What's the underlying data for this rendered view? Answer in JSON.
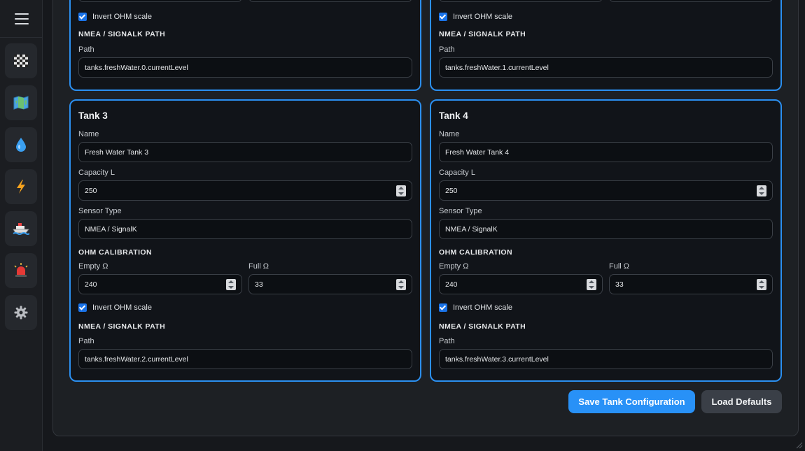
{
  "sidebar": {
    "menu_icon": "hamburger-menu-icon",
    "items": [
      {
        "icon": "checkered-flag-icon",
        "glyph": "🏁"
      },
      {
        "icon": "map-icon",
        "glyph": "🗺️"
      },
      {
        "icon": "water-drop-icon",
        "glyph": "💧"
      },
      {
        "icon": "lightning-icon",
        "glyph": "⚡"
      },
      {
        "icon": "boat-icon",
        "glyph": "🚢"
      },
      {
        "icon": "alarm-light-icon",
        "glyph": "🚨"
      },
      {
        "icon": "gear-icon",
        "glyph": "⚙️"
      }
    ]
  },
  "tanks_top": [
    {
      "invert_label": "Invert OHM scale",
      "path_section": "NMEA / SIGNALK PATH",
      "path_label": "Path",
      "path_value": "tanks.freshWater.0.currentLevel"
    },
    {
      "invert_label": "Invert OHM scale",
      "path_section": "NMEA / SIGNALK PATH",
      "path_label": "Path",
      "path_value": "tanks.freshWater.1.currentLevel"
    }
  ],
  "tanks": [
    {
      "title": "Tank 3",
      "name_label": "Name",
      "name_value": "Fresh Water Tank 3",
      "capacity_label": "Capacity L",
      "capacity_value": "250",
      "sensor_label": "Sensor Type",
      "sensor_value": "NMEA / SignalK",
      "ohm_section": "OHM CALIBRATION",
      "empty_label": "Empty Ω",
      "empty_value": "240",
      "full_label": "Full Ω",
      "full_value": "33",
      "invert_label": "Invert OHM scale",
      "path_section": "NMEA / SIGNALK PATH",
      "path_label": "Path",
      "path_value": "tanks.freshWater.2.currentLevel"
    },
    {
      "title": "Tank 4",
      "name_label": "Name",
      "name_value": "Fresh Water Tank 4",
      "capacity_label": "Capacity L",
      "capacity_value": "250",
      "sensor_label": "Sensor Type",
      "sensor_value": "NMEA / SignalK",
      "ohm_section": "OHM CALIBRATION",
      "empty_label": "Empty Ω",
      "empty_value": "240",
      "full_label": "Full Ω",
      "full_value": "33",
      "invert_label": "Invert OHM scale",
      "path_section": "NMEA / SIGNALK PATH",
      "path_label": "Path",
      "path_value": "tanks.freshWater.3.currentLevel"
    }
  ],
  "actions": {
    "save_label": "Save Tank Configuration",
    "defaults_label": "Load Defaults"
  },
  "colors": {
    "accent": "#2b8ff0",
    "primary_button": "#2891f7",
    "card_background": "#111419"
  }
}
